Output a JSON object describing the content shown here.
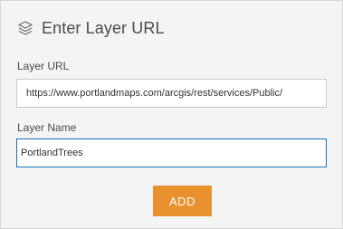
{
  "dialog": {
    "title": "Enter Layer URL",
    "icon": "layers-icon"
  },
  "url_field": {
    "label": "Layer URL",
    "value": "https://www.portlandmaps.com/arcgis/rest/services/Public/"
  },
  "name_field": {
    "label": "Layer Name",
    "value": "PortlandTrees"
  },
  "add_button": {
    "label": "ADD",
    "color": "#e8912e"
  },
  "colors": {
    "accent": "#e8912e",
    "focus_border": "#1a6fb5",
    "background": "#f4f4f4"
  }
}
